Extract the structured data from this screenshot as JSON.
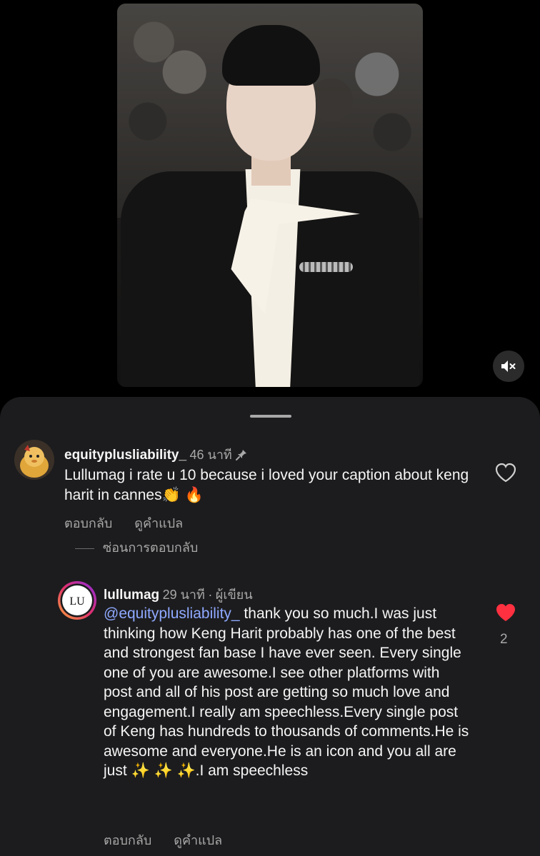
{
  "post": {
    "mute_icon": "speaker-muted-icon"
  },
  "comments": [
    {
      "username": "equityplusliability_",
      "time": "46 นาที",
      "pinned_icon": "pin-icon",
      "text_before": "Lullumag i rate u 10 because i loved your caption about keng harit in cannes",
      "emoji": "👏 🔥",
      "reply_label": "ตอบกลับ",
      "translate_label": "ดูคำแปล",
      "liked": false
    }
  ],
  "hide_replies_label": "ซ่อนการตอบกลับ",
  "reply": {
    "username": "lullumag",
    "time": "29 นาที",
    "separator": "·",
    "author_badge": "ผู้เขียน",
    "avatar_text": "LU",
    "mention": "@equityplusliability_",
    "text": " thank you so much.I was just thinking how Keng Harit probably has one of the best and strongest fan base I have ever seen. Every single one of you are awesome.I see other platforms with post and all of his post are getting so much love and engagement.I really am speechless.Every single post of Keng has hundreds to thousands of comments.He is awesome and everyone.He is an icon and you all are just ",
    "text_end": "✨ ✨ ✨.I  am speechless",
    "reply_label": "ตอบกลับ",
    "translate_label": "ดูคำแปล",
    "like_count": "2",
    "liked": true,
    "like_color": "#ff3040"
  }
}
